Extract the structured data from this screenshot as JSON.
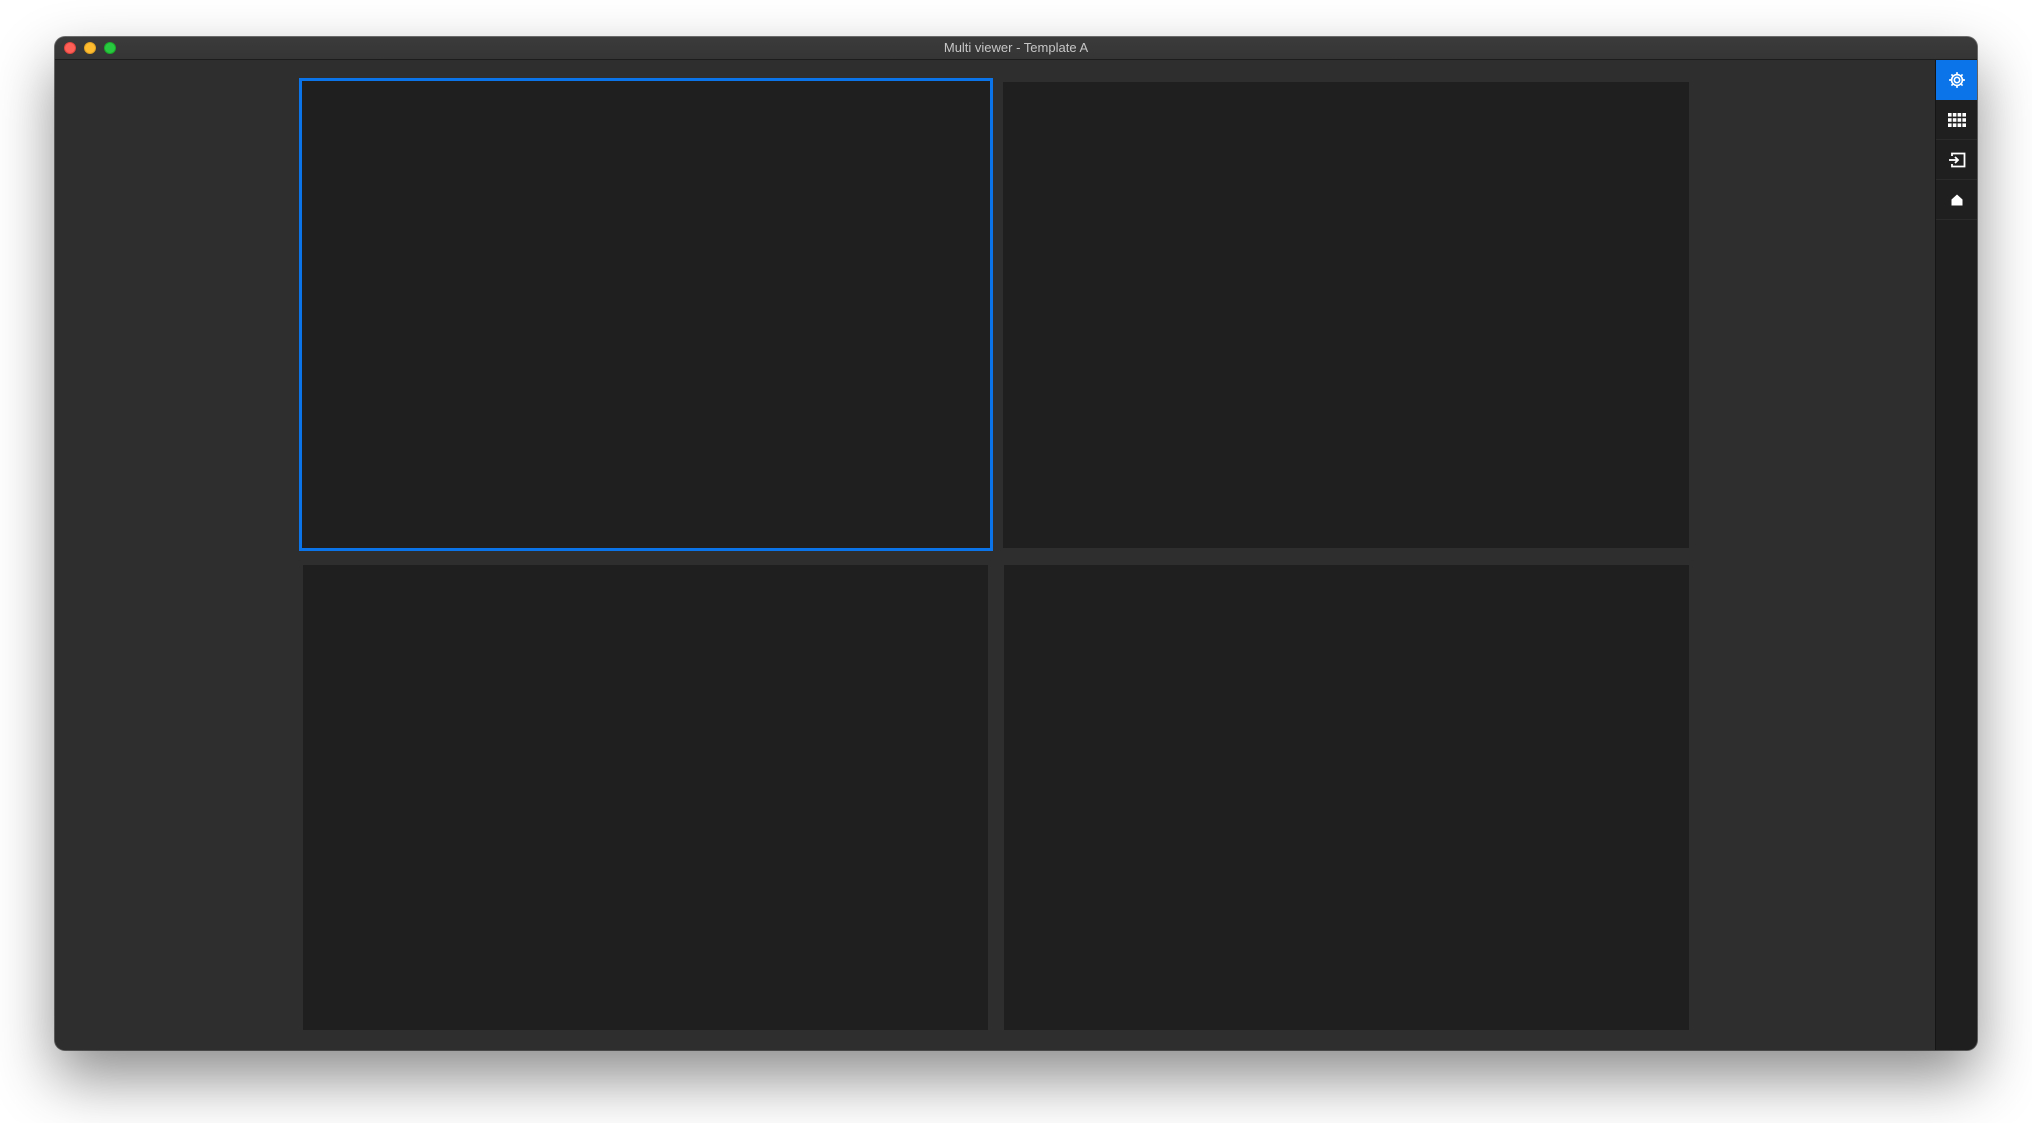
{
  "window": {
    "title": "Multi viewer - Template A"
  },
  "panels": [
    {
      "id": "panel-1",
      "selected": true
    },
    {
      "id": "panel-2",
      "selected": false
    },
    {
      "id": "panel-3",
      "selected": false
    },
    {
      "id": "panel-4",
      "selected": false
    }
  ],
  "sidebar": {
    "buttons": [
      {
        "icon": "gear-icon",
        "active": true
      },
      {
        "icon": "grid-icon",
        "active": false
      },
      {
        "icon": "input-icon",
        "active": false
      },
      {
        "icon": "home-icon",
        "active": false
      }
    ]
  },
  "colors": {
    "accent": "#0a74e8",
    "background": "#2e2e2e",
    "panel": "#1f1f1f"
  }
}
